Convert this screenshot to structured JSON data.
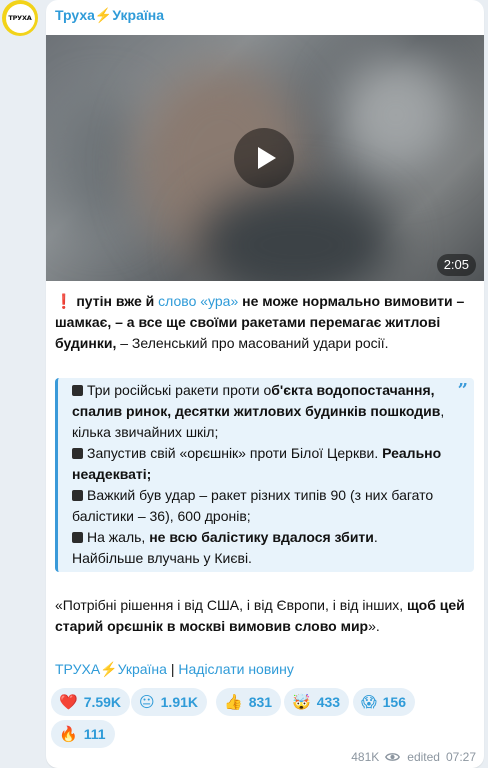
{
  "channel": {
    "avatar_text": "ТРУХА",
    "name": "Труха⚡Україна"
  },
  "video": {
    "duration": "2:05"
  },
  "post": {
    "intro_mark": "❗",
    "intro_a": "путін вже й ",
    "intro_link": "слово «ура»",
    "intro_b": " не може нормально вимовити – шамкає, – а все ще своїми ракетами перемагає житлові будинки,",
    "intro_c": " – Зеленський про масований удари росії."
  },
  "quote": {
    "item1_plain1": "Три російські ракети проти о",
    "item1_bold": "б'єкта водопостачання, спалив ринок, десятки житлових будинків пошкодив",
    "item1_plain2": ", кілька звичайних шкіл;",
    "item2_plain": "Запустив свій «орєшнік» проти Білої Церкви. ",
    "item2_bold": "Реально неадекваті;",
    "item3_plain": "Важкий був удар – ракет різних типів 90 (з них багато балістики – 36), 600 дронів;",
    "item4_plain1": "На жаль, ",
    "item4_bold": "не всю балістику вдалося збити",
    "item4_plain2": ". Найбільше влучань у Києві."
  },
  "closing": {
    "plain1": "«Потрібні рішення і від США, і від Європи, і від інших, ",
    "bold": "щоб цей старий орєшнік в москві вимовив слово мир",
    "plain2": "»."
  },
  "footer": {
    "channel_link": "ТРУХА⚡Україна",
    "separator": " | ",
    "send_news": "Надіслати новину"
  },
  "reactions": [
    {
      "emoji": "❤️",
      "count": "7.59K"
    },
    {
      "emoji": "😐",
      "count": "1.91K"
    },
    {
      "emoji": "👍",
      "count": "831"
    },
    {
      "emoji": "🤯",
      "count": "433"
    },
    {
      "emoji": "😱",
      "count": "156"
    },
    {
      "emoji": "🔥",
      "count": "111"
    }
  ],
  "meta": {
    "views": "481K",
    "edited": "edited",
    "time": "07:27"
  }
}
